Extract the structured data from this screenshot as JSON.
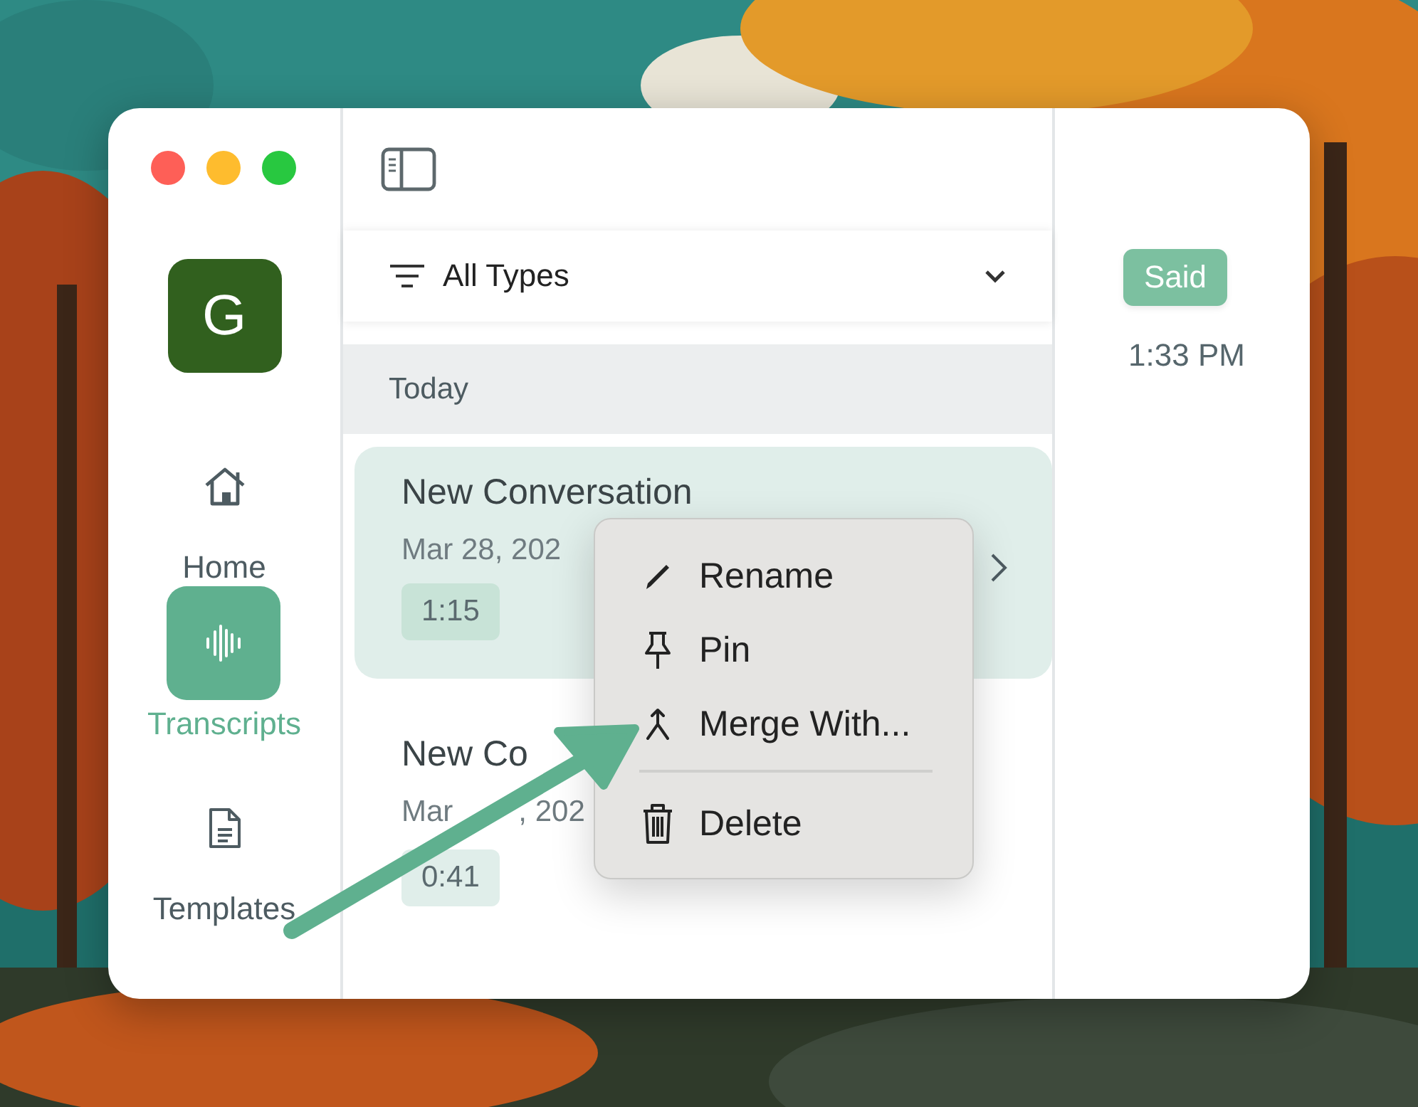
{
  "sidebar": {
    "avatar": "G",
    "nav": [
      {
        "label": "Home",
        "selected": false
      },
      {
        "label": "Transcripts",
        "selected": true
      },
      {
        "label": "Templates",
        "selected": false
      }
    ]
  },
  "filter": {
    "label": "All Types"
  },
  "section": "Today",
  "conversations": [
    {
      "title": "New Conversation",
      "date": "Mar 28, 202",
      "duration": "1:15",
      "selected": true
    },
    {
      "title": "New Co",
      "date": "Mar",
      "date_tail": ", 202",
      "duration": "0:41",
      "selected": false
    }
  ],
  "context_menu": [
    {
      "kind": "item",
      "label": "Rename"
    },
    {
      "kind": "item",
      "label": "Pin"
    },
    {
      "kind": "item",
      "label": "Merge With..."
    },
    {
      "kind": "separator"
    },
    {
      "kind": "item",
      "label": "Delete"
    }
  ],
  "detail": {
    "speaker": "Said",
    "time": "1:33 PM"
  }
}
